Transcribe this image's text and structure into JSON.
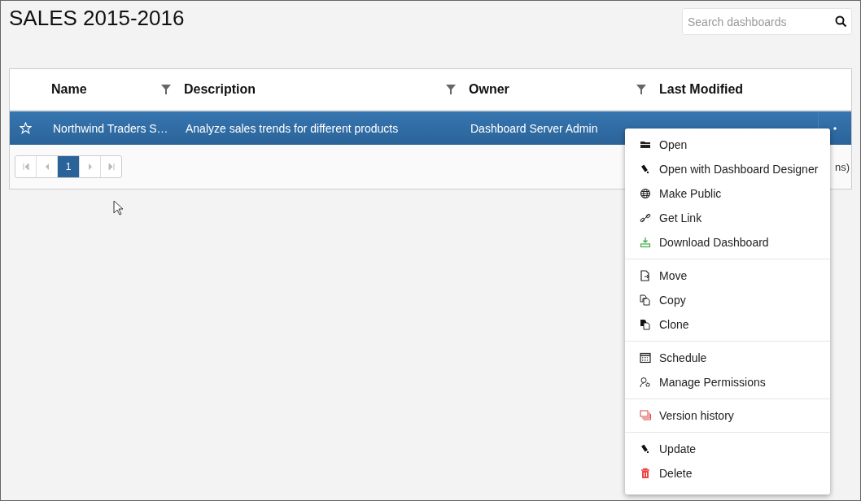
{
  "title": "SALES 2015-2016",
  "search": {
    "placeholder": "Search dashboards"
  },
  "table": {
    "columns": [
      {
        "label": "Name",
        "filter": true
      },
      {
        "label": "Description",
        "filter": true
      },
      {
        "label": "Owner",
        "filter": true
      },
      {
        "label": "Last Modified",
        "filter": false
      }
    ],
    "rows": [
      {
        "favorite": false,
        "selected": true,
        "cells": [
          "Northwind Traders S…",
          "Analyze sales trends for different products",
          "Dashboard Server Admin"
        ]
      }
    ]
  },
  "pager": {
    "pages": [
      {
        "label": "1",
        "selected": true
      }
    ],
    "info": "ns)"
  },
  "menu": [
    [
      {
        "label": "Open"
      },
      {
        "label": "Open with Dashboard Designer"
      },
      {
        "label": "Make Public"
      },
      {
        "label": "Get Link"
      },
      {
        "label": "Download Dashboard"
      }
    ],
    [
      {
        "label": "Move"
      },
      {
        "label": "Copy"
      },
      {
        "label": "Clone"
      }
    ],
    [
      {
        "label": "Schedule"
      },
      {
        "label": "Manage Permissions"
      }
    ],
    [
      {
        "label": "Version history"
      }
    ],
    [
      {
        "label": "Update"
      },
      {
        "label": "Delete"
      }
    ]
  ]
}
